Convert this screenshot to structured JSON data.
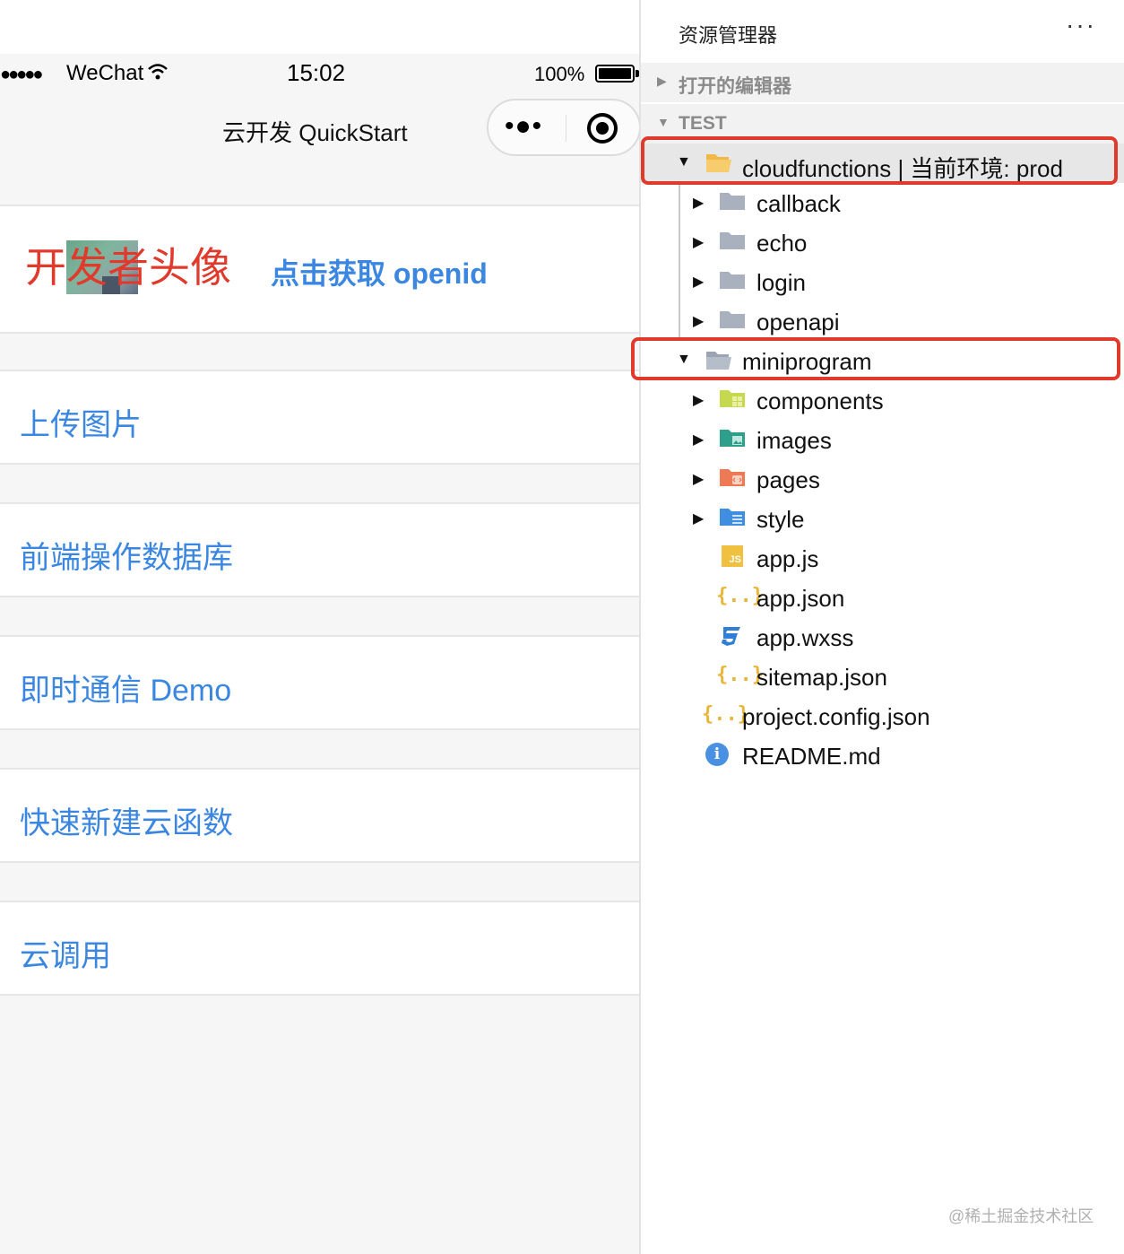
{
  "simulator": {
    "status_bar": {
      "signal": "●●●●●",
      "carrier": "WeChat",
      "time": "15:02",
      "battery_percent": "100%"
    },
    "nav": {
      "title": "云开发 QuickStart",
      "more_glyph": "•●•",
      "close_icon": "target-icon"
    },
    "profile": {
      "avatar_label": "开发者头像",
      "openid_button": "点击获取 openid"
    },
    "menu": [
      {
        "label": "上传图片"
      },
      {
        "label": "前端操作数据库"
      },
      {
        "label": "即时通信 Demo"
      },
      {
        "label": "快速新建云函数"
      },
      {
        "label": "云调用"
      }
    ],
    "colors": {
      "link": "#3a86e0",
      "avatar_label": "#e03a2c",
      "background": "#f6f6f6"
    }
  },
  "explorer": {
    "title": "资源管理器",
    "more": "···",
    "sections": {
      "open_editors": "打开的编辑器",
      "project": "TEST"
    },
    "tree": {
      "cloudfunctions": "cloudfunctions | 当前环境: prod",
      "callback": "callback",
      "echo": "echo",
      "login": "login",
      "openapi": "openapi",
      "miniprogram": "miniprogram",
      "components": "components",
      "images": "images",
      "pages": "pages",
      "style": "style",
      "app_js": "app.js",
      "app_json": "app.json",
      "app_wxss": "app.wxss",
      "sitemap_json": "sitemap.json",
      "project_config": "project.config.json",
      "readme": "README.md"
    },
    "icons": {
      "js_badge": "JS",
      "json_glyph": "{..}",
      "css_glyph": "ƪ",
      "info_glyph": "i"
    },
    "colors": {
      "highlight": "#e03a2c",
      "folder_gray": "#a8b1bd",
      "folder_open": "#f0b848"
    }
  },
  "watermark": "@稀土掘金技术社区"
}
